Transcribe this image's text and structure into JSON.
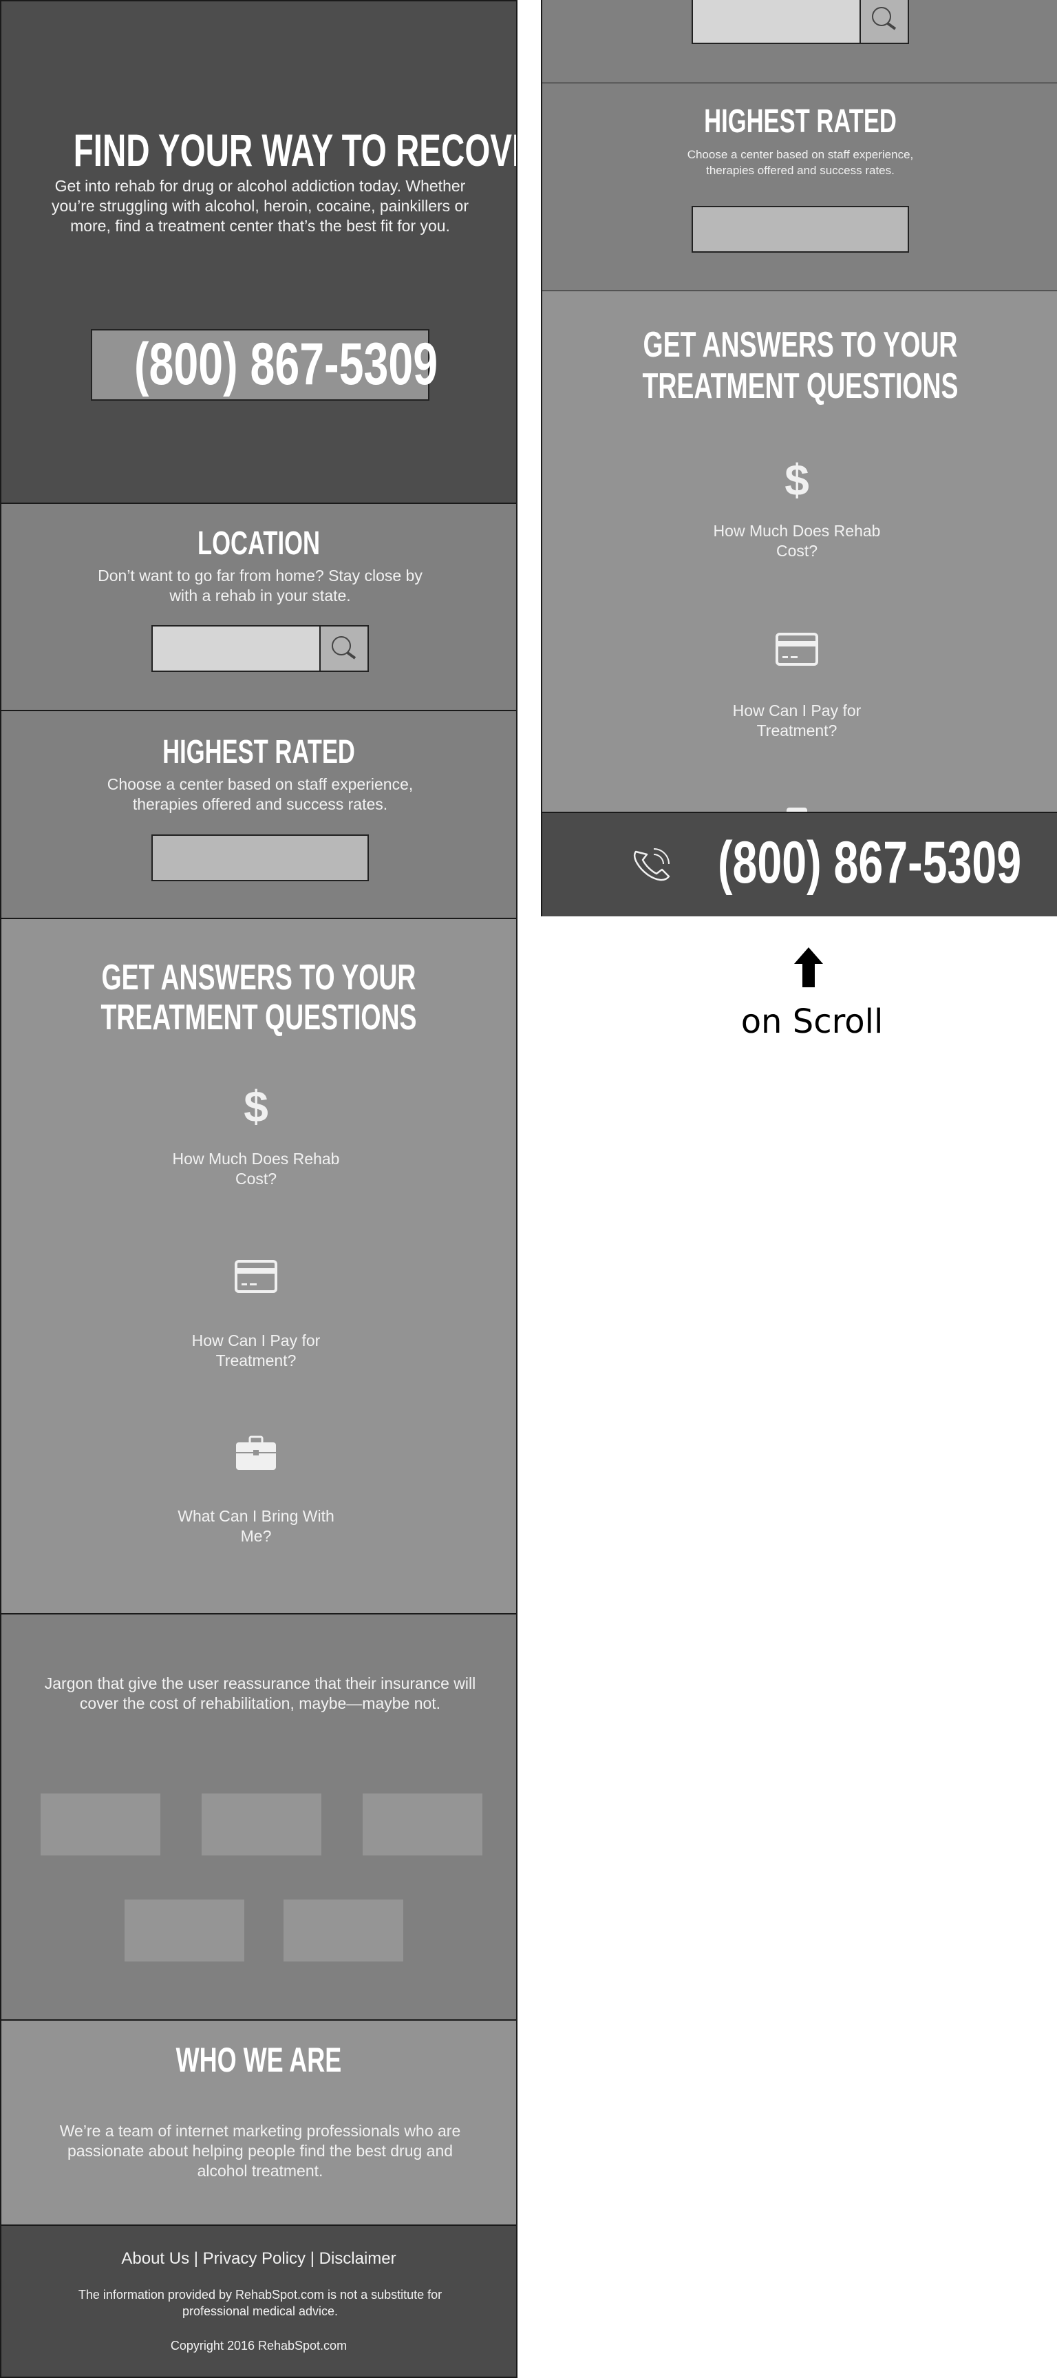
{
  "hero": {
    "title": "FIND YOUR WAY TO RECOVERY",
    "text": "Get into rehab for drug or alcohol addiction today. Whether you’re struggling with alcohol, heroin, cocaine, painkillers or more, find a treatment center that’s the best fit for you.",
    "phone": "(800) 867-5309"
  },
  "location": {
    "title": "LOCATION",
    "text": "Don’t want to go far from home? Stay close by with a rehab in your state.",
    "search_icon": "search-icon"
  },
  "highest_rated": {
    "title": "HIGHEST RATED",
    "text": "Choose a center based on staff experience, therapies offered and success rates."
  },
  "answers": {
    "title_line1": "GET ANSWERS TO YOUR",
    "title_line2": "TREATMENT QUESTIONS",
    "items": [
      {
        "icon": "dollar-icon",
        "label": "How Much Does Rehab Cost?"
      },
      {
        "icon": "credit-card-icon",
        "label": "How Can I Pay for Treatment?"
      },
      {
        "icon": "briefcase-icon",
        "label": "What Can I Bring With Me?"
      }
    ]
  },
  "insurance": {
    "text": "Jargon that give the user reassurance that their insurance will cover the cost of rehabilitation, maybe—maybe not."
  },
  "who": {
    "title": "WHO WE ARE",
    "text": "We’re a team of internet marketing professionals who are passionate about helping people find the best drug and alcohol treatment."
  },
  "footer": {
    "links": [
      "About Us",
      "Privacy Policy",
      "Disclaimer"
    ],
    "separator": "|",
    "disclaimer": "The information provided by RehabSpot.com is not a substitute for professional medical advice.",
    "copyright": "Copyright 2016 RehabSpot.com"
  },
  "sticky": {
    "icon": "phone-icon",
    "phone": "(800) 867-5309"
  },
  "annotation": {
    "label": "on Scroll",
    "icon": "arrow-up-icon"
  },
  "colors": {
    "dark": "#4d4d4d",
    "mid": "#808080",
    "light": "#939393"
  }
}
